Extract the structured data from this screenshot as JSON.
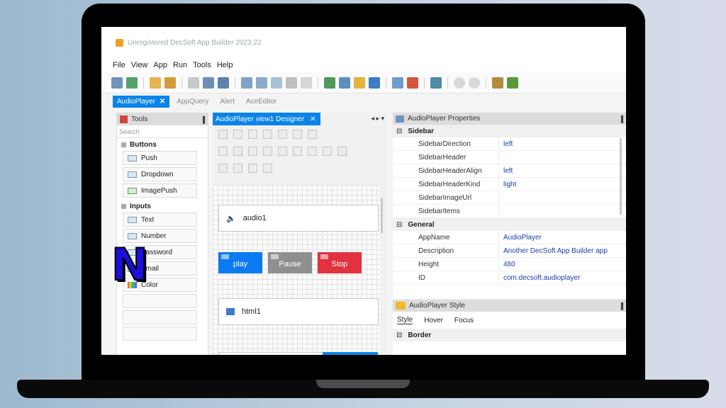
{
  "window": {
    "title": "Unregistered DecSoft App Builder 2023.22"
  },
  "menu": [
    "File",
    "View",
    "App",
    "Run",
    "Tools",
    "Help"
  ],
  "toolbar_icons": [
    "new-app-icon",
    "open-icon",
    "save-icon",
    "copy-icon",
    "paste-icon",
    "undo-icon",
    "redo-icon",
    "view-icon",
    "grid-icon",
    "window-icon",
    "frame-icon",
    "list-icon",
    "build-icon",
    "export-icon",
    "package-icon",
    "deploy-icon",
    "settings-icon",
    "tools-icon",
    "run-icon",
    "stop-icon",
    "download-icon",
    "bug-icon"
  ],
  "doc_tabs": [
    {
      "label": "AudioPlayer",
      "active": true
    },
    {
      "label": "AppQuery",
      "active": false
    },
    {
      "label": "Alert",
      "active": false
    },
    {
      "label": "AceEditor",
      "active": false
    }
  ],
  "tools_panel": {
    "title": "Tools",
    "search_placeholder": "Search",
    "categories": [
      {
        "name": "Buttons",
        "items": [
          "Push",
          "Dropdown",
          "ImagePush"
        ]
      },
      {
        "name": "Inputs",
        "items": [
          "Text",
          "Number",
          "Password",
          "Email",
          "Color",
          "",
          "",
          ""
        ]
      }
    ]
  },
  "designer": {
    "tab_label": "AudioPlayer view1 Designer",
    "components": {
      "audio": "audio1",
      "html": "html1"
    },
    "buttons": [
      {
        "label": "play",
        "color": "#0a7bf0"
      },
      {
        "label": "Pause",
        "color": "#8f8f8f"
      },
      {
        "label": "Stop",
        "color": "#e0323f"
      }
    ]
  },
  "properties": {
    "title": "AudioPlayer Properties",
    "sections": [
      {
        "name": "Sidebar",
        "rows": [
          {
            "key": "SidebarDirection",
            "value": "left"
          },
          {
            "key": "SidebarHeader",
            "value": ""
          },
          {
            "key": "SidebarHeaderAlign",
            "value": "left"
          },
          {
            "key": "SidebarHeaderKind",
            "value": "light"
          },
          {
            "key": "SidebarImageUrl",
            "value": ""
          },
          {
            "key": "SidebarItems",
            "value": ""
          }
        ]
      },
      {
        "name": "General",
        "rows": [
          {
            "key": "AppName",
            "value": "AudioPlayer"
          },
          {
            "key": "Description",
            "value": "Another DecSoft App Builder app"
          },
          {
            "key": "Height",
            "value": "480"
          },
          {
            "key": "ID",
            "value": "com.decsoft.audioplayer"
          }
        ]
      }
    ]
  },
  "style_panel": {
    "title": "AudioPlayer Style",
    "tabs": [
      "Style",
      "Hover",
      "Focus"
    ],
    "section": "Border"
  },
  "overlay_logo": "N",
  "colors": {
    "accent": "#0a84e8",
    "play": "#0a7bf0",
    "pause": "#8f8f8f",
    "stop": "#e0323f"
  }
}
